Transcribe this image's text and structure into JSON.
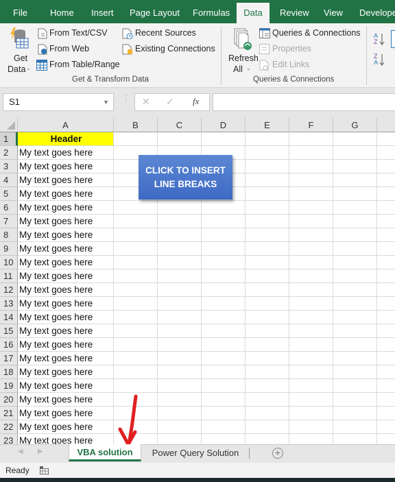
{
  "ribbon_tabs": [
    {
      "label": "File"
    },
    {
      "label": "Home"
    },
    {
      "label": "Insert"
    },
    {
      "label": "Page Layout"
    },
    {
      "label": "Formulas"
    },
    {
      "label": "Data",
      "active": true
    },
    {
      "label": "Review"
    },
    {
      "label": "View"
    },
    {
      "label": "Developer"
    }
  ],
  "ribbon": {
    "get_transform": {
      "get_data_line1": "Get",
      "get_data_line2": "Data",
      "from_text_csv": "From Text/CSV",
      "from_web": "From Web",
      "from_table_range": "From Table/Range",
      "recent_sources": "Recent Sources",
      "existing_connections": "Existing Connections",
      "group_label": "Get & Transform Data"
    },
    "queries": {
      "refresh_line1": "Refresh",
      "refresh_line2": "All",
      "queries_connections": "Queries & Connections",
      "properties": "Properties",
      "edit_links": "Edit Links",
      "group_label": "Queries & Connections"
    }
  },
  "formula_bar": {
    "name_box": "S1",
    "cancel_icon": "✕",
    "enter_icon": "✓",
    "fx_label": "fx",
    "formula": ""
  },
  "columns": [
    "A",
    "B",
    "C",
    "D",
    "E",
    "F",
    "G"
  ],
  "rows": [
    {
      "n": "1",
      "a": "Header"
    },
    {
      "n": "2",
      "a": "My text goes here"
    },
    {
      "n": "3",
      "a": "My text goes here"
    },
    {
      "n": "4",
      "a": "My text goes here"
    },
    {
      "n": "5",
      "a": "My text goes here"
    },
    {
      "n": "6",
      "a": "My text goes here"
    },
    {
      "n": "7",
      "a": "My text goes here"
    },
    {
      "n": "8",
      "a": "My text goes here"
    },
    {
      "n": "9",
      "a": "My text goes here"
    },
    {
      "n": "10",
      "a": "My text goes here"
    },
    {
      "n": "11",
      "a": "My text goes here"
    },
    {
      "n": "12",
      "a": "My text goes here"
    },
    {
      "n": "13",
      "a": "My text goes here"
    },
    {
      "n": "14",
      "a": "My text goes here"
    },
    {
      "n": "15",
      "a": "My text goes here"
    },
    {
      "n": "16",
      "a": "My text goes here"
    },
    {
      "n": "17",
      "a": "My text goes here"
    },
    {
      "n": "18",
      "a": "My text goes here"
    },
    {
      "n": "19",
      "a": "My text goes here"
    },
    {
      "n": "20",
      "a": "My text goes here"
    },
    {
      "n": "21",
      "a": "My text goes here"
    },
    {
      "n": "22",
      "a": "My text goes here"
    },
    {
      "n": "23",
      "a": "My text goes here"
    }
  ],
  "header_fill": "#ffff00",
  "macro_button": {
    "line1": "CLICK TO INSERT",
    "line2": "LINE BREAKS"
  },
  "sheets": [
    {
      "label": "VBA solution",
      "active": true
    },
    {
      "label": "Power Query Solution"
    }
  ],
  "status": {
    "ready": "Ready"
  },
  "colors": {
    "accent": "#217346",
    "button": "#4472c4",
    "arrow": "#e02020"
  }
}
